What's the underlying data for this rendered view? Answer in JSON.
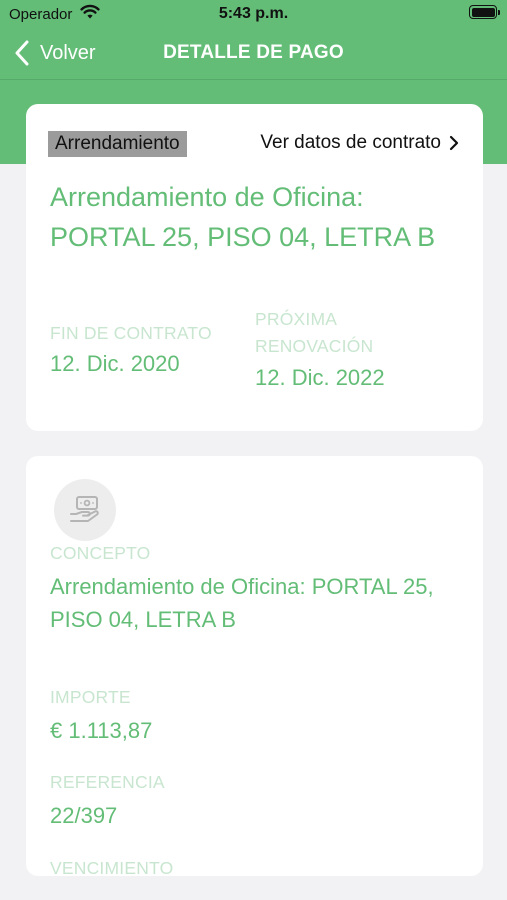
{
  "status_bar": {
    "carrier": "Operador",
    "time": "5:43 p.m."
  },
  "nav": {
    "back_label": "Volver",
    "title": "DETALLE DE PAGO"
  },
  "contract_card": {
    "badge": "Arrendamiento",
    "link_label": "Ver datos de contrato",
    "title": "Arrendamiento de Oficina: PORTAL 25, PISO 04, LETRA B",
    "end_label": "FIN DE CONTRATO",
    "end_value": "12. Dic. 2020",
    "renewal_label": "PRÓXIMA RENOVACIÓN",
    "renewal_value": "12. Dic. 2022"
  },
  "payment_card": {
    "icon": "payment-hand-icon",
    "concept_label": "CONCEPTO",
    "concept_value": "Arrendamiento de Oficina: PORTAL 25, PISO 04, LETRA B",
    "amount_label": "IMPORTE",
    "amount_value": "€ 1.113,87",
    "reference_label": "REFERENCIA",
    "reference_value": "22/397",
    "due_label": "VENCIMIENTO"
  },
  "colors": {
    "primary_green": "#63bd77",
    "label_green": "#c8e6cf",
    "background": "#f2f2f4",
    "badge_gray": "#9b9b9b"
  }
}
